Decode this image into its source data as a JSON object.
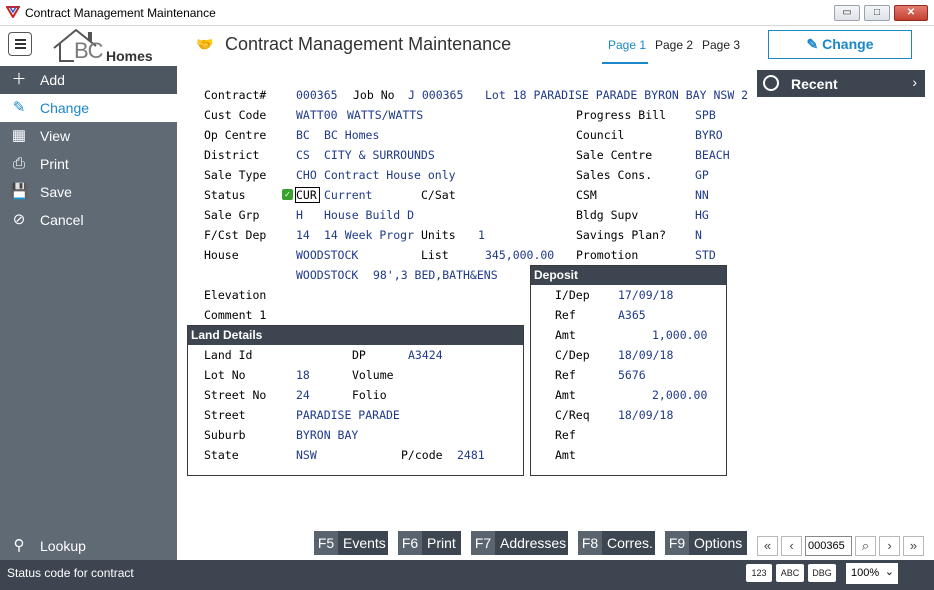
{
  "window": {
    "title": "Contract Management Maintenance",
    "minimize": "▭",
    "restore": "□",
    "close": "✕"
  },
  "header": {
    "logo_bc": "BC",
    "logo_homes": "Homes",
    "page_title": "Contract Management Maintenance",
    "tabs": [
      "Page 1",
      "Page 2",
      "Page 3"
    ],
    "active_tab": "Page 1",
    "change_button": "Change"
  },
  "sidebar": {
    "items": [
      {
        "label": "Add",
        "icon": "plus-icon"
      },
      {
        "label": "Change",
        "icon": "edit-icon"
      },
      {
        "label": "View",
        "icon": "table-icon"
      },
      {
        "label": "Print",
        "icon": "printer-icon"
      },
      {
        "label": "Save",
        "icon": "save-icon"
      },
      {
        "label": "Cancel",
        "icon": "cancel-icon"
      }
    ],
    "active": "Change",
    "lookup": "Lookup"
  },
  "recent": {
    "label": "Recent",
    "arrow": "›"
  },
  "form": {
    "contract_label": "Contract#",
    "contract_value": "000365",
    "job_label": "Job No",
    "job_value": "J 000365",
    "lot_address": "Lot 18 PARADISE PARADE BYRON BAY NSW 2",
    "cust_label": "Cust Code",
    "cust_code": "WATT00",
    "cust_name": "WATTS/WATTS",
    "opc_label": "Op Centre",
    "opc_code": "BC",
    "opc_name": "BC Homes",
    "district_label": "District",
    "district_code": "CS",
    "district_name": "CITY & SURROUNDS",
    "saletype_label": "Sale Type",
    "saletype_code": "CHO",
    "saletype_name": "Contract House only",
    "status_label": "Status",
    "status_code": "CUR",
    "status_name": "Current",
    "csat_label": "C/Sat",
    "salegrp_label": "Sale Grp",
    "salegrp_code": "H",
    "salegrp_name": "House Build D",
    "fcst_label": "F/Cst Dep",
    "fcst_code": "14",
    "fcst_name": "14 Week Progr",
    "units_label": "Units",
    "units_value": "1",
    "house_label": "House",
    "house_code": "WOODSTOCK",
    "list_label": "List",
    "list_value": "345,000.00",
    "house_desc_code": "WOODSTOCK",
    "house_desc": "98',3 BED,BATH&ENS",
    "elevation_label": "Elevation",
    "comment_label": "Comment 1",
    "progress_label": "Progress Bill",
    "progress_value": "SPB",
    "council_label": "Council",
    "council_value": "BYRO",
    "salecentre_label": "Sale Centre",
    "salecentre_value": "BEACH",
    "salescons_label": "Sales Cons.",
    "salescons_value": "GP",
    "csm_label": "CSM",
    "csm_value": "NN",
    "bldgsupv_label": "Bldg Supv",
    "bldgsupv_value": "HG",
    "savings_label": "Savings Plan?",
    "savings_value": "N",
    "promotion_label": "Promotion",
    "promotion_value": "STD"
  },
  "land": {
    "title": "Land Details",
    "landid_label": "Land Id",
    "dp_label": "DP",
    "dp_value": "A3424",
    "lotno_label": "Lot No",
    "lotno_value": "18",
    "volume_label": "Volume",
    "streetno_label": "Street No",
    "streetno_value": "24",
    "folio_label": "Folio",
    "street_label": "Street",
    "street_value": "PARADISE PARADE",
    "suburb_label": "Suburb",
    "suburb_value": "BYRON BAY",
    "state_label": "State",
    "state_value": "NSW",
    "pcode_label": "P/code",
    "pcode_value": "2481"
  },
  "deposit": {
    "title": "Deposit",
    "idep_label": "I/Dep",
    "idep_value": "17/09/18",
    "ref1_label": "Ref",
    "ref1_value": "A365",
    "amt1_label": "Amt",
    "amt1_value": "1,000.00",
    "cdep_label": "C/Dep",
    "cdep_value": "18/09/18",
    "ref2_label": "Ref",
    "ref2_value": "5676",
    "amt2_label": "Amt",
    "amt2_value": "2,000.00",
    "creq_label": "C/Req",
    "creq_value": "18/09/18",
    "ref3_label": "Ref",
    "amt3_label": "Amt"
  },
  "fkeys": [
    {
      "key": "F5",
      "label": "Events"
    },
    {
      "key": "F6",
      "label": "Print"
    },
    {
      "key": "F7",
      "label": "Addresses"
    },
    {
      "key": "F8",
      "label": "Corres."
    },
    {
      "key": "F9",
      "label": "Options"
    }
  ],
  "nav": {
    "record": "000365",
    "first": "«",
    "prev": "‹",
    "search": "⌕",
    "next": "›",
    "last": "»"
  },
  "statusbar": {
    "text": "Status code for contract",
    "btn123": "123",
    "btnabc": "ABC",
    "btndbg": "DBG",
    "zoom": "100%",
    "zoom_arrow": "⌄"
  }
}
